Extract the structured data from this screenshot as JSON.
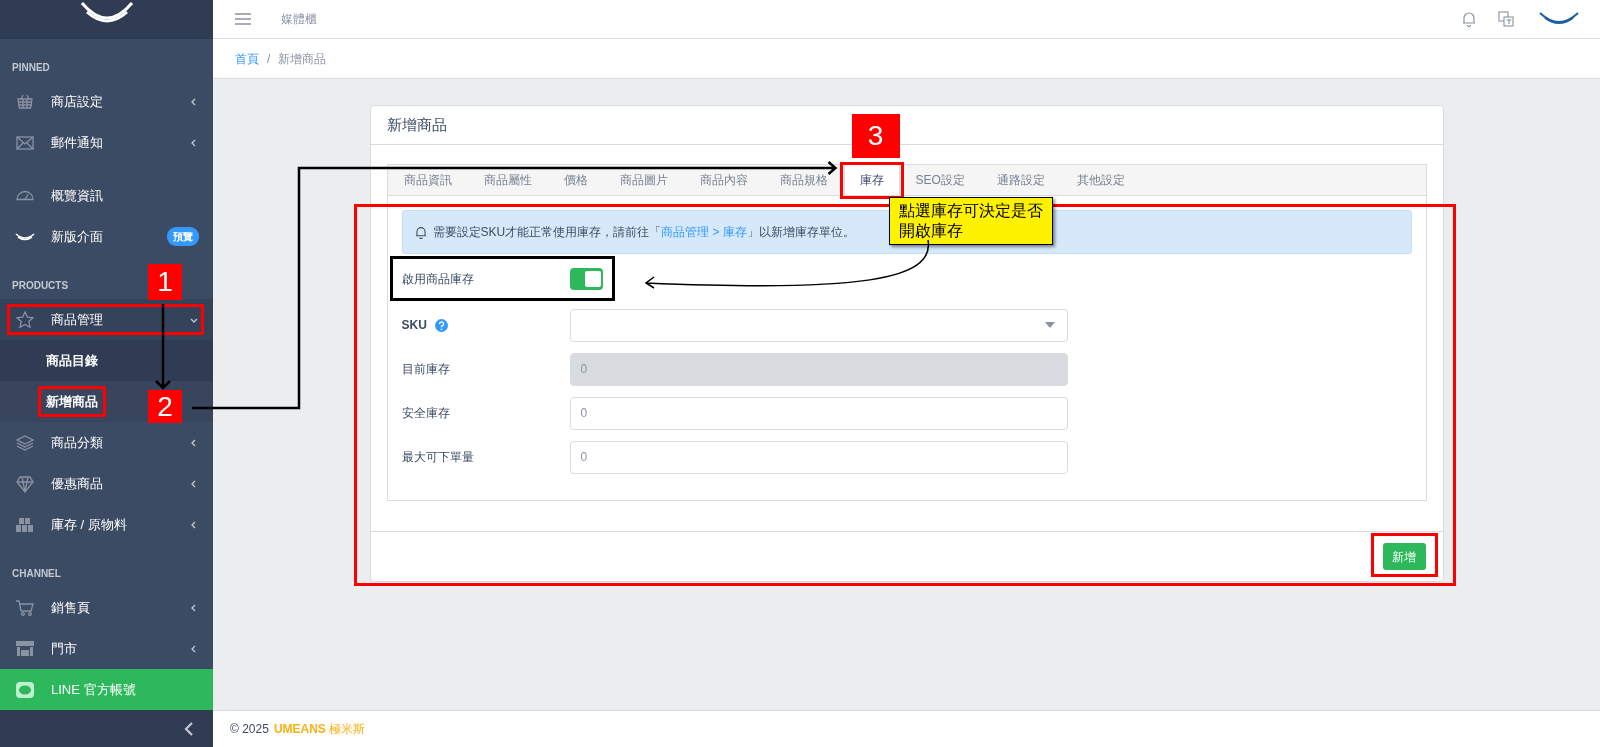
{
  "sidebar": {
    "sections": [
      {
        "heading": "PINNED",
        "items": [
          {
            "label": "商店設定",
            "expanded": false
          },
          {
            "label": "郵件通知",
            "expanded": false
          }
        ]
      },
      {
        "items": [
          {
            "label": "概覽資訊"
          },
          {
            "label": "新版介面",
            "badge": "預覽"
          }
        ]
      },
      {
        "heading": "PRODUCTS",
        "items": [
          {
            "label": "商品管理",
            "expanded": true,
            "children": [
              {
                "label": "商品目錄",
                "selected": false
              },
              {
                "label": "新增商品",
                "selected": true
              }
            ]
          },
          {
            "label": "商品分類",
            "expanded": false
          },
          {
            "label": "優惠商品",
            "expanded": false
          },
          {
            "label": "庫存 / 原物料",
            "expanded": false
          }
        ]
      },
      {
        "heading": "CHANNEL",
        "items": [
          {
            "label": "銷售頁",
            "kind": "menu",
            "expanded": false
          },
          {
            "label": "門市",
            "kind": "menu",
            "expanded": false
          },
          {
            "label": "LINE 官方帳號",
            "kind": "line"
          }
        ]
      }
    ]
  },
  "topbar": {
    "title": "媒體櫃"
  },
  "breadcrumb": {
    "items": [
      {
        "label": "首頁",
        "link": true
      },
      {
        "label": "新增商品",
        "link": false
      }
    ],
    "separator": "/"
  },
  "card": {
    "title": "新增商品",
    "tabs": [
      {
        "label": "商品資訊",
        "selected": false
      },
      {
        "label": "商品屬性",
        "selected": false
      },
      {
        "label": "價格",
        "selected": false
      },
      {
        "label": "商品圖片",
        "selected": false
      },
      {
        "label": "商品內容",
        "selected": false
      },
      {
        "label": "商品規格",
        "selected": false
      },
      {
        "label": "庫存",
        "selected": true
      },
      {
        "label": "SEO設定",
        "selected": false
      },
      {
        "label": "通路設定",
        "selected": false
      },
      {
        "label": "其他設定",
        "selected": false
      }
    ],
    "alert": {
      "text_before": "需要設定SKU才能正常使用庫存，請前往「",
      "link": "商品管理 > 庫存",
      "text_after": "」以新增庫存單位。"
    },
    "fields": [
      {
        "kind": "toggle",
        "label": "啟用商品庫存",
        "on": true
      },
      {
        "kind": "select",
        "label": "SKU",
        "help": true
      },
      {
        "kind": "input",
        "label": "目前庫存",
        "value": "0",
        "disabled": true
      },
      {
        "kind": "input",
        "label": "安全庫存",
        "placeholder": "0",
        "disabled": false
      },
      {
        "kind": "input",
        "label": "最大可下單量",
        "placeholder": "0",
        "disabled": false
      }
    ],
    "submit": "新增"
  },
  "footer": {
    "copyright": "© 2025",
    "brand": "**UMEANS** 極米斯"
  },
  "annotations": {
    "steps": [
      "1",
      "2",
      "3"
    ],
    "callout": "點選庫存可決定是否開啟庫存"
  }
}
